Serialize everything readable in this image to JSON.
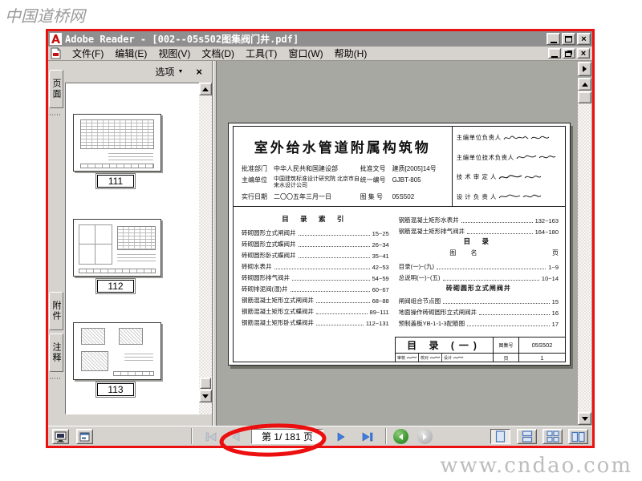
{
  "colors": {
    "annotation-red": "#ec0f0f",
    "chrome": "#d6d3ce",
    "chrome-dark": "#808080",
    "titlebar": "#8f8f8f",
    "doc-bg": "#a8a8a2",
    "nav-blue": "#3e7de0",
    "nav-disabled": "#c3cad4",
    "view-green": "#4a9a33"
  },
  "watermarks": {
    "top_left": "中国道桥网",
    "bottom_right": "www.cndao.com"
  },
  "titlebar": {
    "title": "Adobe Reader - [002--05s502图集阀门井.pdf]",
    "close_glyph": "×"
  },
  "menubar": {
    "items": [
      {
        "label": "文件(F)"
      },
      {
        "label": "编辑(E)"
      },
      {
        "label": "视图(V)"
      },
      {
        "label": "文档(D)"
      },
      {
        "label": "工具(T)"
      },
      {
        "label": "窗口(W)"
      },
      {
        "label": "帮助(H)"
      }
    ],
    "close_glyph": "×"
  },
  "sidebar_tabs": [
    {
      "label": "页面"
    },
    {
      "label": "附件"
    },
    {
      "label": "注释"
    }
  ],
  "pages_panel": {
    "options_label": "选项",
    "options_caret": "▼",
    "close_glyph": "×",
    "thumbnails": [
      {
        "page_number": "111"
      },
      {
        "page_number": "112"
      },
      {
        "page_number": "113"
      }
    ]
  },
  "pdf_page": {
    "title": "室外给水管道附属构筑物",
    "meta_rows": [
      {
        "label": "批准部门",
        "value": "中华人民共和国建设部",
        "label2": "批准文号",
        "value2": "建质[2005]14号"
      },
      {
        "label": "主编单位",
        "value": "中国建筑标准设计研究院 北京市自来水设计公司",
        "label2": "统一编号",
        "value2": "GJBT-805"
      },
      {
        "label": "实行日期",
        "value": "二〇〇五年三月一日",
        "label2": "图 集 号",
        "value2": "05S502"
      }
    ],
    "signature_rows": [
      {
        "label": "主编单位负责人"
      },
      {
        "label": "主编单位技术负责人"
      },
      {
        "label": "技 术 审 定 人"
      },
      {
        "label": "设 计 负 责 人"
      }
    ],
    "toc_index_title": "目 录 索 引",
    "toc_left": [
      {
        "name": "砖砌圆形立式闸阀井",
        "pages": "15~25"
      },
      {
        "name": "砖砌圆形立式蝶阀井",
        "pages": "26~34"
      },
      {
        "name": "砖砌圆形卧式蝶阀井",
        "pages": "35~41"
      },
      {
        "name": "砖砌水表井",
        "pages": "42~53"
      },
      {
        "name": "砖砌圆形排气阀井",
        "pages": "54~59"
      },
      {
        "name": "砖砌排泥阀(湿)井",
        "pages": "60~67"
      },
      {
        "name": "钢筋混凝土矩形立式闸阀井",
        "pages": "68~88"
      },
      {
        "name": "钢筋混凝土矩形立式蝶阀井",
        "pages": "89~111"
      },
      {
        "name": "钢筋混凝土矩形卧式蝶阀井",
        "pages": "112~131"
      }
    ],
    "toc_right_top": [
      {
        "name": "钢筋混凝土矩形水表井",
        "pages": "132~163"
      },
      {
        "name": "钢筋混凝土矩形排气阀井",
        "pages": "164~180"
      }
    ],
    "toc_catalog_title": "目 录",
    "toc_col_name": "图 名",
    "toc_col_page": "页",
    "toc_right_entries": [
      {
        "name": "目录(一)~(九)",
        "pages": "1~9"
      },
      {
        "name": "总说明(一)~(五)",
        "pages": "10~14"
      }
    ],
    "toc_section_title": "砖砌圆形立式闸阀井",
    "toc_section_entries": [
      {
        "name": "闸阀组合节点图",
        "pages": "15"
      },
      {
        "name": "地面操作砖砌圆形立式闸阀井",
        "pages": "16"
      },
      {
        "name": "预制盖板YB-1-1-3配筋图",
        "pages": "17"
      }
    ],
    "footer": {
      "title": "目 录 (一)",
      "atlas_label": "图集号",
      "atlas_value": "05S502",
      "page_label": "页",
      "page_value": "1",
      "review_cells": [
        "审核",
        "校对",
        "设计"
      ]
    }
  },
  "statusbar": {
    "page_field": "第 1/ 181 页"
  }
}
